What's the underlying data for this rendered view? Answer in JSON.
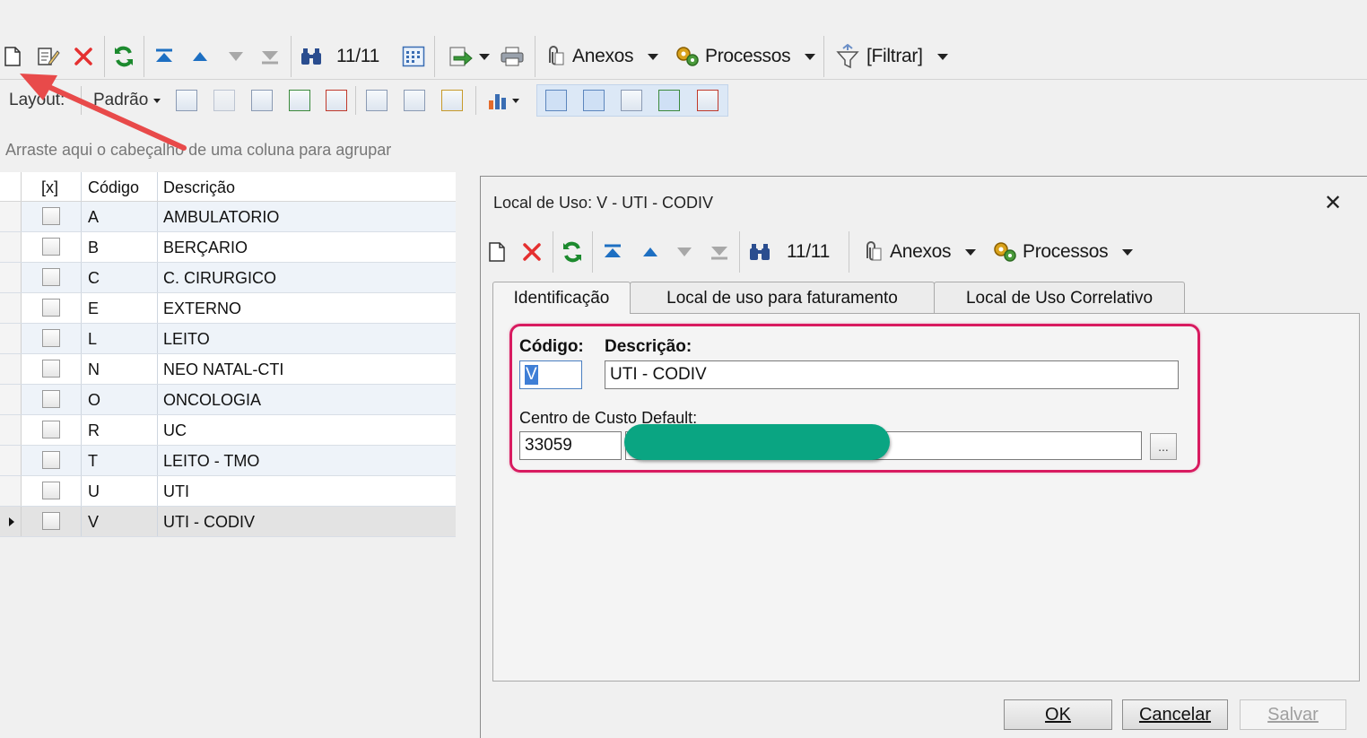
{
  "toolbar": {
    "record_counter": "11/11",
    "anexos_label": "Anexos",
    "processos_label": "Processos",
    "filtrar_label": "[Filtrar]"
  },
  "layout_bar": {
    "layout_label": "Layout:",
    "padrao_label": "Padrão"
  },
  "group_hint": "Arraste aqui o cabeçalho de uma coluna para agrupar",
  "grid": {
    "headers": {
      "check": "[x]",
      "code": "Código",
      "desc": "Descrição"
    },
    "rows": [
      {
        "code": "A",
        "desc": "AMBULATORIO"
      },
      {
        "code": "B",
        "desc": "BERÇARIO"
      },
      {
        "code": "C",
        "desc": "C. CIRURGICO"
      },
      {
        "code": "E",
        "desc": "EXTERNO"
      },
      {
        "code": "L",
        "desc": "LEITO"
      },
      {
        "code": "N",
        "desc": "NEO NATAL-CTI"
      },
      {
        "code": "O",
        "desc": "ONCOLOGIA"
      },
      {
        "code": "R",
        "desc": "UC"
      },
      {
        "code": "T",
        "desc": "LEITO - TMO"
      },
      {
        "code": "U",
        "desc": "UTI"
      },
      {
        "code": "V",
        "desc": "UTI - CODIV"
      }
    ]
  },
  "dialog": {
    "title": "Local de Uso: V - UTI - CODIV",
    "close_symbol": "✕",
    "record_counter": "11/11",
    "anexos_label": "Anexos",
    "processos_label": "Processos",
    "tabs": [
      "Identificação",
      "Local de uso para faturamento",
      "Local de Uso Correlativo"
    ],
    "codigo_label": "Código:",
    "codigo_value": "V",
    "descricao_label": "Descrição:",
    "descricao_value": "UTI - CODIV",
    "centro_label": "Centro de Custo Default:",
    "centro_value": "33059",
    "ellipsis": "...",
    "ok_label": "OK",
    "cancelar_label": "Cancelar",
    "salvar_label": "Salvar"
  },
  "colors": {
    "annotation_red": "#e84a4a",
    "highlight_pink": "#d81b60",
    "redaction_green": "#0aa582"
  }
}
